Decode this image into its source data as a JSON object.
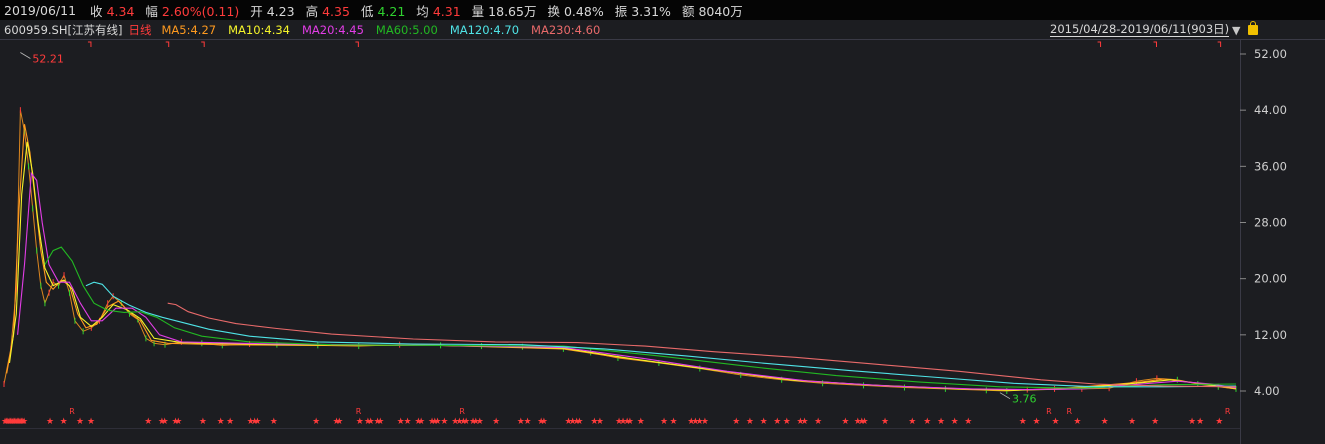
{
  "quote": {
    "date": "2019/06/11",
    "items": [
      {
        "label": "收",
        "value": "4.34",
        "tone": "up"
      },
      {
        "label": "幅",
        "value": "2.60%(0.11)",
        "tone": "up"
      },
      {
        "label": "开",
        "value": "4.23",
        "tone": "plain"
      },
      {
        "label": "高",
        "value": "4.35",
        "tone": "up"
      },
      {
        "label": "低",
        "value": "4.21",
        "tone": "down"
      },
      {
        "label": "均",
        "value": "4.31",
        "tone": "up"
      },
      {
        "label": "量",
        "value": "18.65万",
        "tone": "plain"
      },
      {
        "label": "换",
        "value": "0.48%",
        "tone": "plain"
      },
      {
        "label": "振",
        "value": "3.31%",
        "tone": "plain"
      },
      {
        "label": "额",
        "value": "8040万",
        "tone": "plain"
      }
    ]
  },
  "legend": {
    "code": "600959.SH",
    "name": "[江苏有线]",
    "period": "日线",
    "ma": [
      {
        "label": "MA5:4.27",
        "color": "#ff9a1f"
      },
      {
        "label": "MA10:4.34",
        "color": "#f5f52a"
      },
      {
        "label": "MA20:4.45",
        "color": "#e23de6"
      },
      {
        "label": "MA60:5.00",
        "color": "#22b822"
      },
      {
        "label": "MA120:4.70",
        "color": "#4fe3e6"
      },
      {
        "label": "MA230:4.60",
        "color": "#e86a6a"
      }
    ]
  },
  "range": {
    "text": "2015/04/28-2019/06/11(903日)"
  },
  "colors": {
    "up": "#ff3b3b",
    "down": "#2fd12f",
    "background": "#1c1d21",
    "grid": "#3a3a46"
  },
  "icons": {
    "range_toggle": "triangle-down",
    "lock": "lock-icon"
  },
  "chart_data": {
    "type": "line",
    "title": "600959.SH 江苏有线 日线",
    "ylim": [
      3.0,
      53.0
    ],
    "yticks": [
      "52.00",
      "44.00",
      "36.00",
      "28.00",
      "20.00",
      "12.00",
      "4.00"
    ],
    "ytick_values": [
      52,
      44,
      36,
      28,
      20,
      12,
      4
    ],
    "x_count": 903,
    "annotations": [
      {
        "text": "52.21",
        "x": 12,
        "y": 52.21
      },
      {
        "text": "3.76",
        "x": 730,
        "y": 3.76
      }
    ],
    "series": [
      {
        "name": "price",
        "color": "#ff9a1f",
        "points": [
          [
            0,
            5.0
          ],
          [
            5,
            10.0
          ],
          [
            9,
            18.5
          ],
          [
            12,
            44.0
          ],
          [
            15,
            41.0
          ],
          [
            18,
            36.0
          ],
          [
            21,
            30.0
          ],
          [
            24,
            24.0
          ],
          [
            27,
            19.0
          ],
          [
            30,
            16.5
          ],
          [
            33,
            18.0
          ],
          [
            36,
            19.5
          ],
          [
            40,
            19.0
          ],
          [
            44,
            20.5
          ],
          [
            48,
            18.0
          ],
          [
            52,
            14.0
          ],
          [
            58,
            12.5
          ],
          [
            64,
            13.0
          ],
          [
            70,
            14.0
          ],
          [
            76,
            16.5
          ],
          [
            80,
            17.5
          ],
          [
            86,
            16.5
          ],
          [
            92,
            15.0
          ],
          [
            98,
            14.2
          ],
          [
            104,
            11.5
          ],
          [
            110,
            10.8
          ],
          [
            118,
            10.6
          ],
          [
            130,
            11.0
          ],
          [
            145,
            10.8
          ],
          [
            160,
            10.5
          ],
          [
            180,
            10.7
          ],
          [
            200,
            10.6
          ],
          [
            230,
            10.5
          ],
          [
            260,
            10.4
          ],
          [
            290,
            10.6
          ],
          [
            320,
            10.5
          ],
          [
            350,
            10.4
          ],
          [
            380,
            10.3
          ],
          [
            410,
            10.0
          ],
          [
            430,
            9.5
          ],
          [
            450,
            8.7
          ],
          [
            480,
            8.0
          ],
          [
            510,
            7.2
          ],
          [
            540,
            6.3
          ],
          [
            570,
            5.6
          ],
          [
            600,
            5.1
          ],
          [
            630,
            4.8
          ],
          [
            660,
            4.5
          ],
          [
            690,
            4.3
          ],
          [
            720,
            4.1
          ],
          [
            735,
            4.0
          ],
          [
            750,
            4.2
          ],
          [
            770,
            4.3
          ],
          [
            790,
            4.3
          ],
          [
            810,
            4.4
          ],
          [
            830,
            5.4
          ],
          [
            845,
            5.8
          ],
          [
            860,
            5.6
          ],
          [
            875,
            5.0
          ],
          [
            890,
            4.6
          ],
          [
            903,
            4.3
          ]
        ]
      },
      {
        "name": "MA5",
        "color": "#ff9a1f",
        "points": [
          [
            2,
            6.5
          ],
          [
            7,
            12.0
          ],
          [
            11,
            30.0
          ],
          [
            15,
            42.0
          ],
          [
            19,
            38.0
          ],
          [
            23,
            31.0
          ],
          [
            27,
            24.0
          ],
          [
            31,
            19.5
          ],
          [
            36,
            18.5
          ],
          [
            42,
            19.8
          ],
          [
            48,
            19.0
          ],
          [
            54,
            15.0
          ],
          [
            60,
            13.0
          ],
          [
            68,
            13.5
          ],
          [
            76,
            16.0
          ],
          [
            84,
            16.8
          ],
          [
            92,
            15.2
          ],
          [
            100,
            14.0
          ],
          [
            108,
            11.2
          ],
          [
            120,
            10.8
          ],
          [
            160,
            10.6
          ],
          [
            230,
            10.5
          ],
          [
            320,
            10.5
          ],
          [
            410,
            10.0
          ],
          [
            450,
            8.8
          ],
          [
            510,
            7.3
          ],
          [
            570,
            5.7
          ],
          [
            630,
            4.9
          ],
          [
            690,
            4.4
          ],
          [
            735,
            4.1
          ],
          [
            770,
            4.3
          ],
          [
            830,
            5.2
          ],
          [
            850,
            5.7
          ],
          [
            875,
            5.1
          ],
          [
            903,
            4.3
          ]
        ]
      },
      {
        "name": "MA10",
        "color": "#f5f52a",
        "points": [
          [
            4,
            8.0
          ],
          [
            9,
            15.0
          ],
          [
            13,
            32.0
          ],
          [
            17,
            39.5
          ],
          [
            21,
            35.0
          ],
          [
            25,
            28.0
          ],
          [
            30,
            21.5
          ],
          [
            36,
            19.0
          ],
          [
            44,
            19.8
          ],
          [
            50,
            18.5
          ],
          [
            56,
            14.5
          ],
          [
            64,
            13.2
          ],
          [
            72,
            14.5
          ],
          [
            80,
            16.3
          ],
          [
            90,
            15.6
          ],
          [
            100,
            14.3
          ],
          [
            110,
            11.5
          ],
          [
            130,
            10.9
          ],
          [
            200,
            10.6
          ],
          [
            320,
            10.5
          ],
          [
            410,
            10.1
          ],
          [
            460,
            8.6
          ],
          [
            520,
            7.0
          ],
          [
            580,
            5.5
          ],
          [
            640,
            4.8
          ],
          [
            700,
            4.3
          ],
          [
            740,
            4.1
          ],
          [
            780,
            4.3
          ],
          [
            835,
            5.2
          ],
          [
            855,
            5.6
          ],
          [
            880,
            5.0
          ],
          [
            903,
            4.35
          ]
        ]
      },
      {
        "name": "MA20",
        "color": "#e23de6",
        "points": [
          [
            10,
            12.0
          ],
          [
            15,
            22.0
          ],
          [
            20,
            35.0
          ],
          [
            24,
            34.0
          ],
          [
            28,
            28.0
          ],
          [
            33,
            22.0
          ],
          [
            40,
            19.5
          ],
          [
            48,
            19.5
          ],
          [
            56,
            16.5
          ],
          [
            64,
            14.0
          ],
          [
            72,
            14.0
          ],
          [
            82,
            15.8
          ],
          [
            94,
            15.8
          ],
          [
            104,
            14.5
          ],
          [
            114,
            12.0
          ],
          [
            130,
            11.0
          ],
          [
            200,
            10.7
          ],
          [
            320,
            10.5
          ],
          [
            410,
            10.2
          ],
          [
            470,
            8.6
          ],
          [
            530,
            6.8
          ],
          [
            590,
            5.4
          ],
          [
            650,
            4.7
          ],
          [
            710,
            4.3
          ],
          [
            750,
            4.2
          ],
          [
            790,
            4.3
          ],
          [
            840,
            5.1
          ],
          [
            860,
            5.4
          ],
          [
            885,
            5.0
          ],
          [
            903,
            4.45
          ]
        ]
      },
      {
        "name": "MA60",
        "color": "#22b822",
        "points": [
          [
            30,
            22.0
          ],
          [
            36,
            24.0
          ],
          [
            42,
            24.5
          ],
          [
            50,
            22.5
          ],
          [
            58,
            19.0
          ],
          [
            66,
            16.5
          ],
          [
            76,
            15.5
          ],
          [
            88,
            15.2
          ],
          [
            100,
            15.3
          ],
          [
            112,
            14.5
          ],
          [
            125,
            13.0
          ],
          [
            145,
            11.8
          ],
          [
            180,
            11.0
          ],
          [
            240,
            10.6
          ],
          [
            320,
            10.5
          ],
          [
            410,
            10.4
          ],
          [
            480,
            9.0
          ],
          [
            550,
            7.4
          ],
          [
            610,
            6.2
          ],
          [
            670,
            5.3
          ],
          [
            730,
            4.6
          ],
          [
            790,
            4.4
          ],
          [
            850,
            4.9
          ],
          [
            903,
            5.0
          ]
        ]
      },
      {
        "name": "MA120",
        "color": "#4fe3e6",
        "points": [
          [
            60,
            19.0
          ],
          [
            66,
            19.5
          ],
          [
            72,
            19.2
          ],
          [
            80,
            17.5
          ],
          [
            92,
            16.2
          ],
          [
            104,
            15.2
          ],
          [
            116,
            14.5
          ],
          [
            130,
            13.8
          ],
          [
            150,
            12.8
          ],
          [
            180,
            11.8
          ],
          [
            230,
            11.0
          ],
          [
            300,
            10.7
          ],
          [
            380,
            10.6
          ],
          [
            440,
            10.0
          ],
          [
            500,
            9.0
          ],
          [
            560,
            7.9
          ],
          [
            620,
            6.9
          ],
          [
            680,
            6.0
          ],
          [
            740,
            5.1
          ],
          [
            800,
            4.6
          ],
          [
            850,
            4.6
          ],
          [
            903,
            4.7
          ]
        ]
      },
      {
        "name": "MA230",
        "color": "#e86a6a",
        "points": [
          [
            120,
            16.5
          ],
          [
            126,
            16.3
          ],
          [
            135,
            15.3
          ],
          [
            150,
            14.4
          ],
          [
            170,
            13.6
          ],
          [
            200,
            12.9
          ],
          [
            240,
            12.1
          ],
          [
            300,
            11.4
          ],
          [
            360,
            11.0
          ],
          [
            420,
            10.9
          ],
          [
            470,
            10.4
          ],
          [
            520,
            9.6
          ],
          [
            580,
            8.8
          ],
          [
            640,
            7.8
          ],
          [
            700,
            6.8
          ],
          [
            760,
            5.6
          ],
          [
            800,
            5.0
          ],
          [
            850,
            4.7
          ],
          [
            903,
            4.6
          ]
        ]
      }
    ],
    "markers": {
      "top_flags": [
        63,
        120,
        146,
        259,
        803,
        844,
        891
      ],
      "bottom_stars": [
        0,
        1,
        2,
        3,
        4,
        5,
        6,
        7,
        8,
        9,
        10,
        11,
        12,
        13,
        14,
        33,
        43,
        55,
        63,
        105,
        115,
        117,
        125,
        127,
        145,
        158,
        165,
        180,
        183,
        185,
        197,
        228,
        243,
        245,
        260,
        266,
        268,
        273,
        275,
        290,
        295,
        303,
        305,
        313,
        315,
        317,
        322,
        330,
        333,
        336,
        338,
        343,
        345,
        348,
        360,
        378,
        383,
        393,
        395,
        413,
        416,
        419,
        421,
        432,
        436,
        450,
        453,
        456,
        458,
        466,
        483,
        490,
        503,
        506,
        509,
        513,
        536,
        546,
        556,
        566,
        573,
        583,
        586,
        596,
        616,
        625,
        628,
        630,
        645,
        665,
        676,
        686,
        696,
        706,
        746,
        756,
        770,
        786,
        806,
        826,
        843,
        870,
        876,
        890
      ],
      "bottom_r": [
        50,
        260,
        336,
        766,
        781,
        897
      ]
    }
  }
}
